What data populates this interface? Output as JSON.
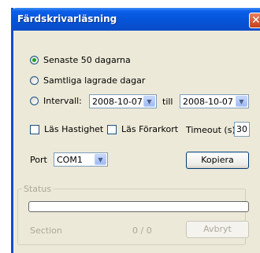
{
  "window": {
    "title": "Färdskrivarläsning"
  },
  "options": {
    "last50_label": "Senaste 50 dagarna",
    "all_label": "Samtliga lagrade dagar",
    "interval_label": "Intervall:",
    "from_date": "2008-10-07",
    "till_label": "till",
    "to_date": "2008-10-07",
    "selected": "last50"
  },
  "settings": {
    "speed_label": "Läs Hastighet",
    "driver_card_label": "Läs Förarkort",
    "timeout_label": "Timeout (s)",
    "timeout_value": "30",
    "port_label": "Port",
    "port_value": "COM1",
    "copy_button": "Kopiera"
  },
  "status": {
    "group_label": "Status",
    "progress": 0,
    "section_label": "Section",
    "counter": "0 / 0",
    "cancel_button": "Avbryt"
  }
}
